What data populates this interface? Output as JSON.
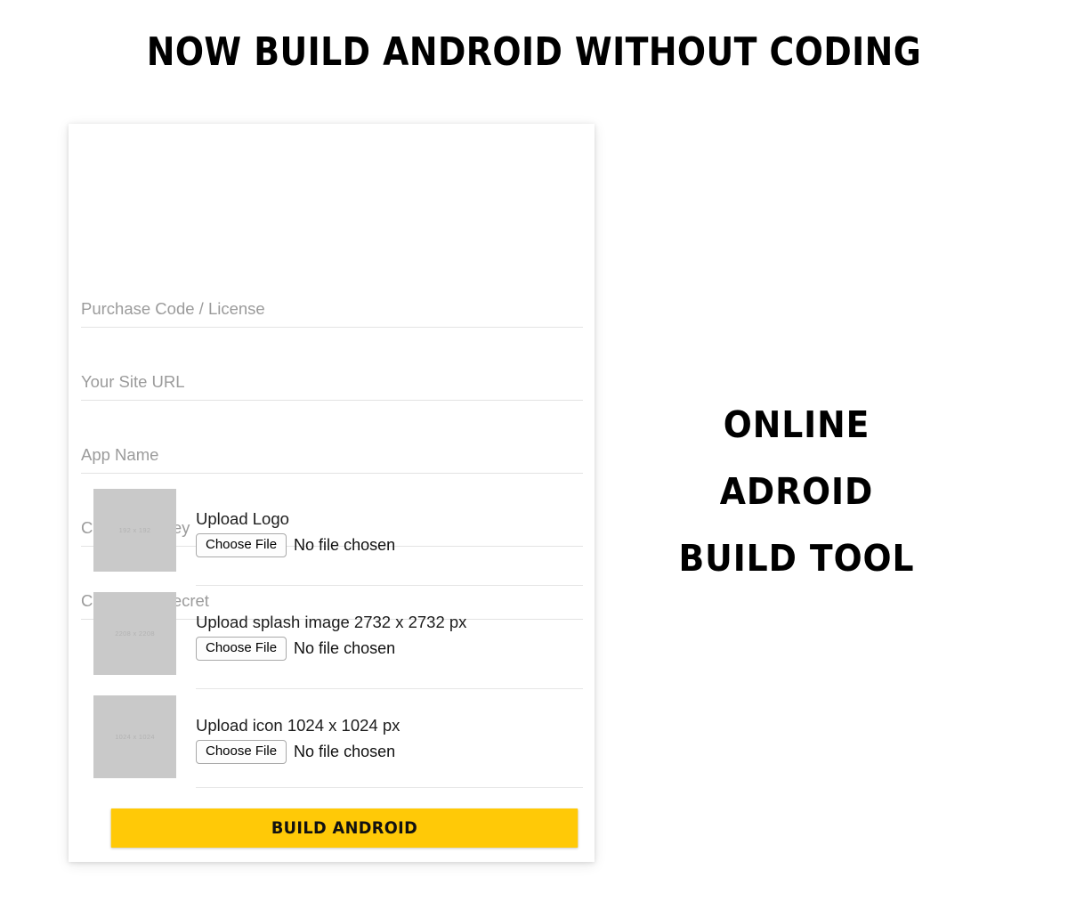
{
  "headline": "NOW BUILD ANDROID WITHOUT CODING",
  "colors": {
    "accent_yellow": "#ffc907",
    "thumb_gray": "#c9c9c9",
    "placeholder_text": "#9b9b9b",
    "underline": "#e3e3e3",
    "page_background": "#ffffff",
    "card_background": "#ffffff"
  },
  "form": {
    "fields": [
      {
        "name": "purchase-code",
        "placeholder": "Purchase Code / License",
        "value": ""
      },
      {
        "name": "site-url",
        "placeholder": "Your Site URL",
        "value": ""
      },
      {
        "name": "app-name",
        "placeholder": "App Name",
        "value": ""
      },
      {
        "name": "consumer-key",
        "placeholder": "Consumer Key",
        "value": ""
      },
      {
        "name": "consumer-secret",
        "placeholder": "Consumer Secret",
        "value": ""
      }
    ],
    "uploads": [
      {
        "name": "logo",
        "title": "Upload Logo",
        "thumb_label": "192 x 192",
        "choose_label": "Choose File",
        "file_status": "No file chosen"
      },
      {
        "name": "splash",
        "title": "Upload splash image 2732 x 2732 px",
        "thumb_label": "2208 x 2208",
        "choose_label": "Choose File",
        "file_status": "No file chosen"
      },
      {
        "name": "icon",
        "title": "Upload icon 1024 x 1024 px",
        "thumb_label": "1024 x 1024",
        "choose_label": "Choose File",
        "file_status": "No file chosen"
      }
    ],
    "submit_label": "BUILD ANDROID"
  },
  "tagline": {
    "line1": "ONLINE",
    "line2": "ADROID",
    "line3": "BUILD TOOL"
  }
}
